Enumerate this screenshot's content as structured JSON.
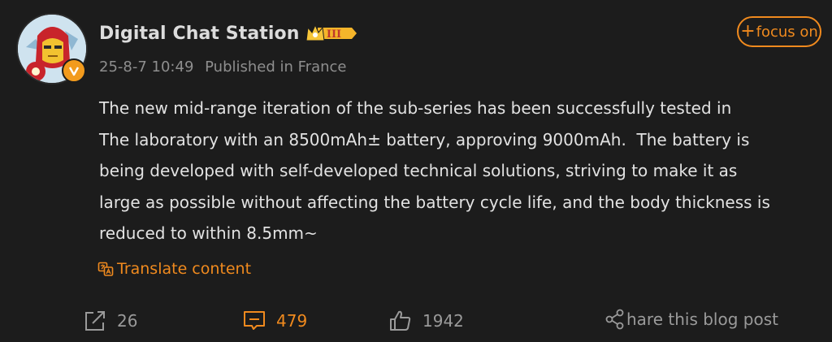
{
  "post": {
    "author": "Digital Chat Station",
    "level_badge": "III",
    "date": "25-8-7 10:49",
    "location": "Published in France",
    "follow_label": "focus on",
    "follow_prefix": "+",
    "content": "The new mid-range iteration of the sub-series has been successfully tested in\nThe laboratory with an 8500mAh± battery, approving 9000mAh.  The battery is\nbeing developed with self-developed technical solutions, striving to make it as\nlarge as possible without affecting the battery cycle life, and the body thickness is\nreduced to within 8.5mm~",
    "translate_label": "Translate content"
  },
  "actions": {
    "repost_count": "26",
    "comment_count": "479",
    "like_count": "1942",
    "share_label": "hare this blog post"
  },
  "colors": {
    "accent": "#f08a1e",
    "background": "#1c1c1c",
    "muted": "#8e8e8e"
  },
  "icons": {
    "avatar": "iron-man-avatar",
    "verified": "verified-v-icon",
    "crown": "crown-badge-icon",
    "translate": "translate-icon",
    "repost": "repost-icon",
    "comment": "comment-icon",
    "like": "thumbs-up-icon",
    "share": "share-icon"
  }
}
